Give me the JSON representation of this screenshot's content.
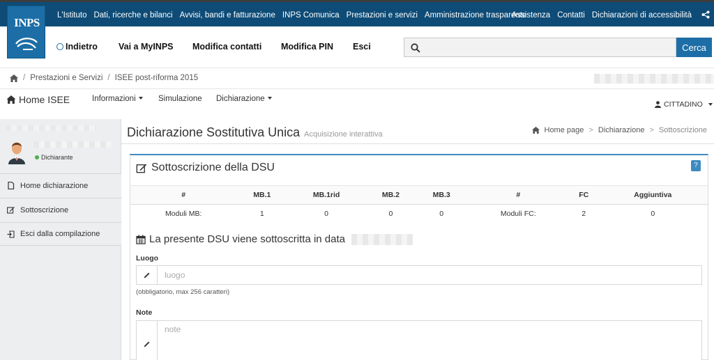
{
  "colors": {
    "topbar": "#0e4c77",
    "accent": "#1d6ea6",
    "panel_border": "#3d8bbf",
    "status_green": "#4caf50"
  },
  "logo": {
    "text": "INPS"
  },
  "topnav": {
    "left": [
      "L'Istituto",
      "Dati, ricerche e bilanci",
      "Avvisi, bandi e fatturazione",
      "INPS Comunica",
      "Prestazioni e servizi",
      "Amministrazione trasparente"
    ],
    "right": [
      "Assistenza",
      "Contatti",
      "Dichiarazioni di accessibilità"
    ],
    "share_icon": "share-icon"
  },
  "secondnav": {
    "back": "Indietro",
    "myinps": "Vai a MyINPS",
    "contatti": "Modifica contatti",
    "pin": "Modifica PIN",
    "esci": "Esci"
  },
  "search": {
    "value": "",
    "placeholder": "",
    "button": "Cerca"
  },
  "breadcrumb": {
    "items": [
      "Prestazioni e Servizi",
      "ISEE post-riforma 2015"
    ]
  },
  "appnav": {
    "home": "Home ISEE",
    "informazioni": "Informazioni",
    "simulazione": "Simulazione",
    "dichiarazione": "Dichiarazione",
    "user": "CITTADINO"
  },
  "sidebar": {
    "status": "Dichiarante",
    "items": [
      {
        "label": "Home dichiarazione",
        "icon": "document-icon"
      },
      {
        "label": "Sottoscrizione",
        "icon": "edit-icon"
      },
      {
        "label": "Esci dalla compilazione",
        "icon": "signout-icon"
      }
    ]
  },
  "main": {
    "title": "Dichiarazione Sostitutiva Unica",
    "subtitle": "Acquisizione interattiva",
    "breadcrumb": [
      "Home page",
      "Dichiarazione",
      "Sottoscrizione"
    ]
  },
  "panel": {
    "title": "Sottoscrizione della DSU",
    "help": "?",
    "table": {
      "headers": [
        "#",
        "MB.1",
        "MB.1rid",
        "MB.2",
        "MB.3",
        "#",
        "FC",
        "Aggiuntiva"
      ],
      "row": [
        "Moduli MB:",
        "1",
        "0",
        "0",
        "0",
        "Moduli FC:",
        "2",
        "0"
      ]
    },
    "dsu_text": "La presente DSU viene sottoscritta in data",
    "luogo": {
      "label": "Luogo",
      "placeholder": "luogo",
      "value": "",
      "hint": "(obbligatorio, max 256 caratteri)"
    },
    "note": {
      "label": "Note",
      "placeholder": "note",
      "value": ""
    }
  }
}
